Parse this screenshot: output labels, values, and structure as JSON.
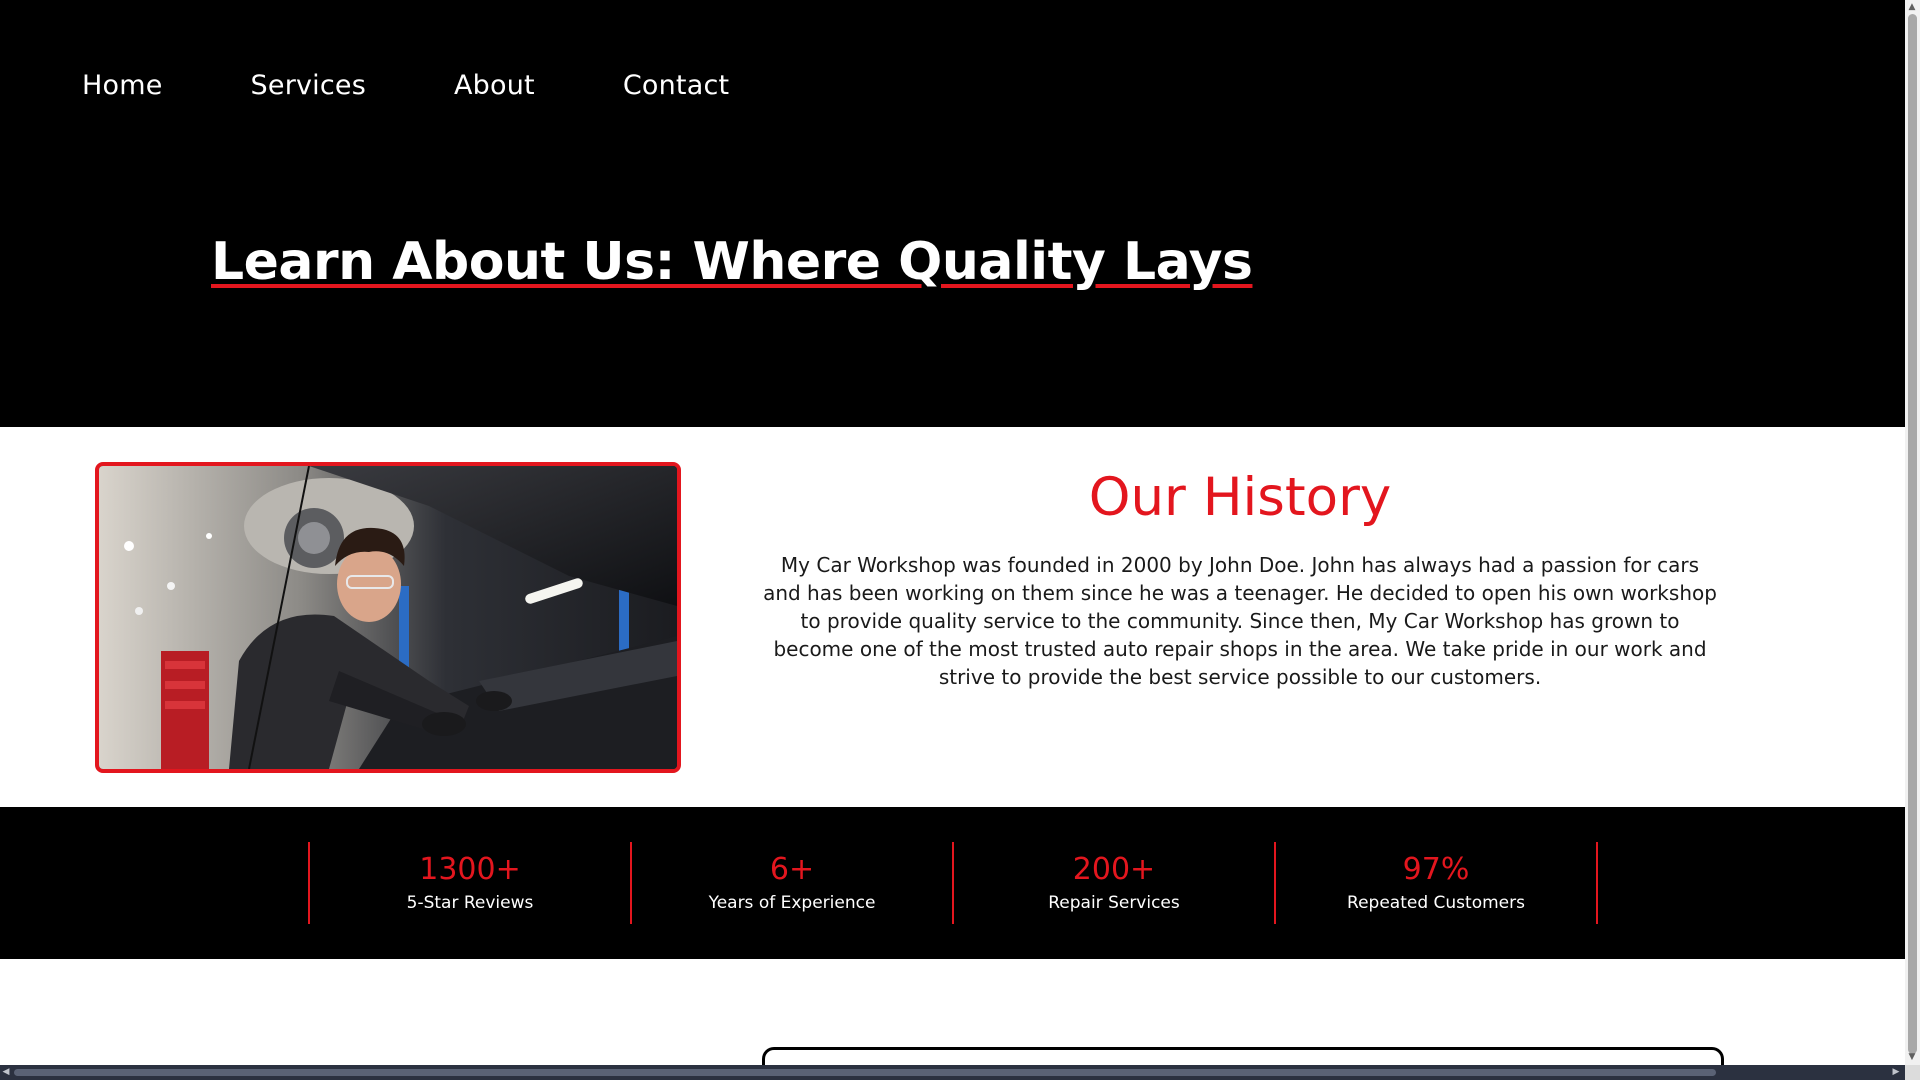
{
  "nav": {
    "items": [
      "Home",
      "Services",
      "About",
      "Contact"
    ]
  },
  "hero": {
    "title": "Learn About Us: Where Quality Lays"
  },
  "history": {
    "title": "Our History",
    "text": "My Car Workshop was founded in 2000 by John Doe. John has always had a passion for cars and has been working on them since he was a teenager. He decided to open his own workshop to provide quality service to the community. Since then, My Car Workshop has grown to become one of the most trusted auto repair shops in the area. We take pride in our work and strive to provide the best service possible to our customers.",
    "image": "mechanic-photo"
  },
  "stats": [
    {
      "value": "1300+",
      "label": "5-Star Reviews"
    },
    {
      "value": "6+",
      "label": "Years of Experience"
    },
    {
      "value": "200+",
      "label": "Repair Services"
    },
    {
      "value": "97%",
      "label": "Repeated Customers"
    }
  ],
  "colors": {
    "accent": "#e3161e",
    "background_dark": "#000000",
    "background_light": "#ffffff"
  }
}
